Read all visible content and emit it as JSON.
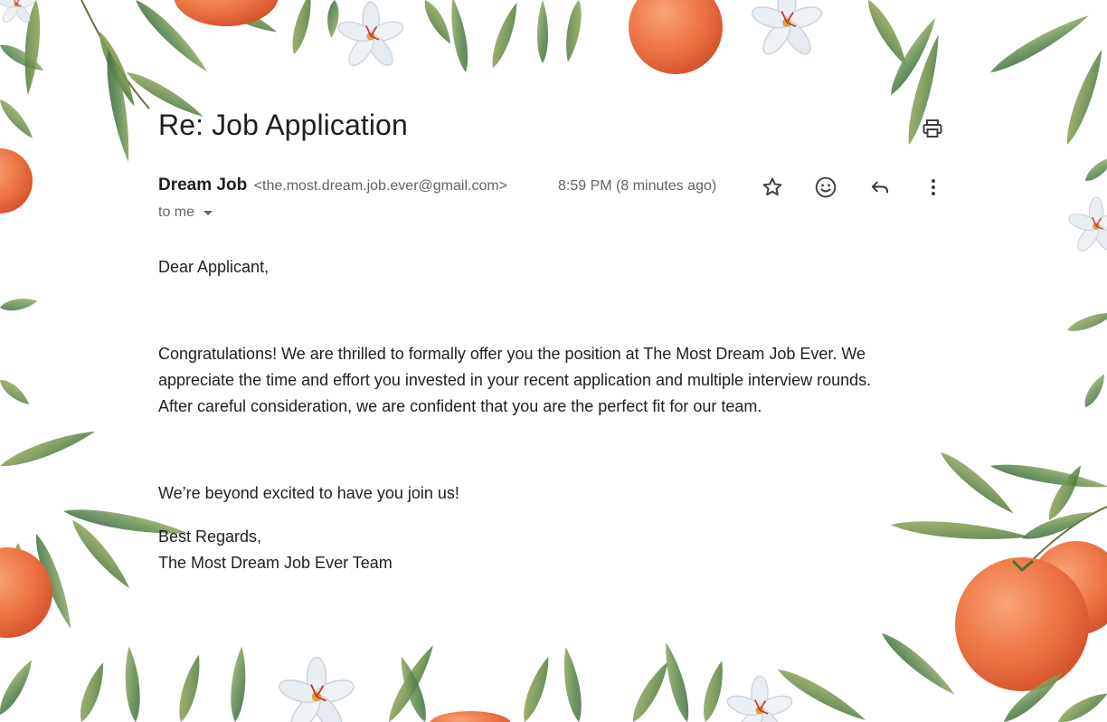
{
  "email": {
    "subject": "Re: Job Application",
    "sender_name": "Dream Job",
    "sender_email": "<the.most.dream.job.ever@gmail.com>",
    "timestamp": "8:59 PM (8 minutes ago)",
    "recipient": "to me",
    "body": {
      "greeting": "Dear Applicant,",
      "paragraph_lines": [
        "Congratulations! We are thrilled to formally offer you the position at The Most Dream Job Ever. We",
        "appreciate the time and effort you invested in your recent application and multiple interview rounds.",
        "After careful consideration, we are confident that you are the perfect fit for our team."
      ],
      "closing": "We’re beyond excited to have you join us!",
      "regards": "Best Regards,",
      "signature": "The Most Dream Job Ever Team"
    }
  },
  "icons": {
    "print": "print-icon",
    "star": "star-icon",
    "emoji": "emoji-reaction-icon",
    "reply": "reply-icon",
    "more": "more-vert-icon",
    "dropdown": "dropdown-caret-icon"
  },
  "colors": {
    "leaf_green": "#6f8f4a",
    "leaf_dark": "#3f6b3a",
    "orange": "#ef7a4a",
    "orange_dark": "#d9532a",
    "blossom": "#e8edf1",
    "text_primary": "#1f1f1f",
    "text_secondary": "#5f6368"
  }
}
